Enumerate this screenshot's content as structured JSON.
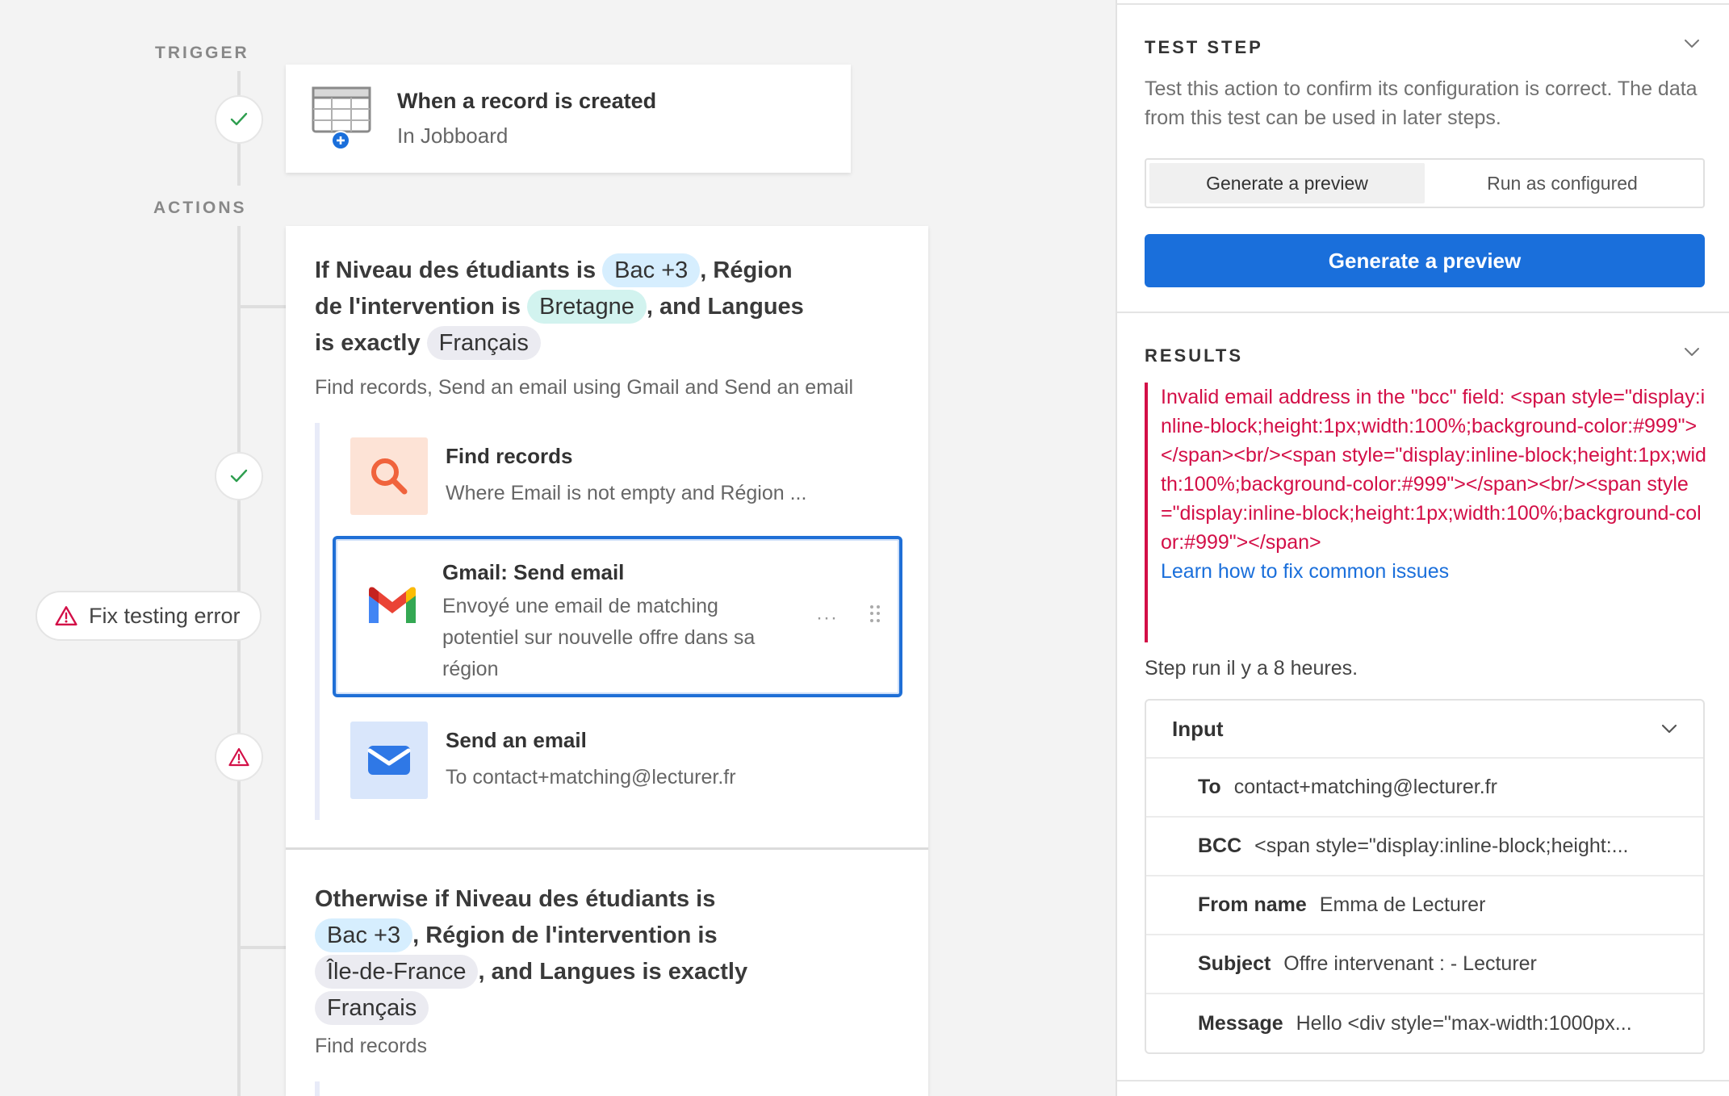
{
  "workflow": {
    "trigger_label": "TRIGGER",
    "actions_label": "ACTIONS",
    "fix_error_label": "Fix testing error",
    "trigger": {
      "title": "When a record is created",
      "subtitle": "In Jobboard",
      "icon": "table-plus-icon"
    },
    "branch1": {
      "cond_prefix": "If Niveau des étudiants is",
      "chip1": "Bac +3",
      "cond_mid1": ", Région",
      "cond_mid2": "de l'intervention is",
      "chip2": "Bretagne",
      "cond_mid3": ", and Langues",
      "cond_mid4": "is exactly",
      "chip3": "Français",
      "summary": "Find records, Send an email using Gmail and Send an email",
      "steps": [
        {
          "title": "Find records",
          "desc": "Where Email is not empty and Région ...",
          "icon": "search-icon"
        },
        {
          "title": "Gmail: Send email",
          "desc": "Envoyé une email de matching potentiel sur nouvelle offre dans sa région",
          "icon": "gmail-icon"
        },
        {
          "title": "Send an email",
          "desc": "To contact+matching@lecturer.fr",
          "icon": "envelope-icon"
        }
      ],
      "more_label": "···"
    },
    "branch2": {
      "cond_prefix": "Otherwise if Niveau des étudiants is",
      "chip1": "Bac +3",
      "cond_mid1": ", Région de l'intervention is",
      "chip2": "Île-de-France",
      "cond_mid2": ", and Langues is exactly",
      "chip3": "Français",
      "summary": "Find records"
    }
  },
  "panel": {
    "test_step": {
      "title": "TEST STEP",
      "description": "Test this action to confirm its configuration is correct. The data from this test can be used in later steps.",
      "tabs": [
        "Generate a preview",
        "Run as configured"
      ],
      "active_tab": "Generate a preview",
      "button_label": "Generate a preview"
    },
    "results": {
      "title": "RESULTS",
      "error": "Invalid email address in the \"bcc\" field: <span style=\"display:inline-block;height:1px;width:100%;background-color:#999\"></span><br/><span style=\"display:inline-block;height:1px;width:100%;background-color:#999\"></span><br/><span style=\"display:inline-block;height:1px;width:100%;background-color:#999\"></span>",
      "link": "Learn how to fix common issues",
      "step_run": "Step run il y a 8 heures."
    },
    "input": {
      "title": "Input",
      "rows": [
        {
          "key": "To",
          "value": "contact+matching@lecturer.fr"
        },
        {
          "key": "BCC",
          "value": "<span style=\"display:inline-block;height:..."
        },
        {
          "key": "From name",
          "value": "Emma de Lecturer"
        },
        {
          "key": "Subject",
          "value": "Offre intervenant : - Lecturer"
        },
        {
          "key": "Message",
          "value": "Hello <div style=\"max-width:1000px..."
        }
      ]
    }
  },
  "colors": {
    "accent": "#1a6fdb",
    "error": "#d30f47",
    "success": "#2e9e4f",
    "chip_blue": "#d6eefe",
    "chip_teal": "#d2f3ef",
    "chip_gray": "#ebebf1"
  }
}
